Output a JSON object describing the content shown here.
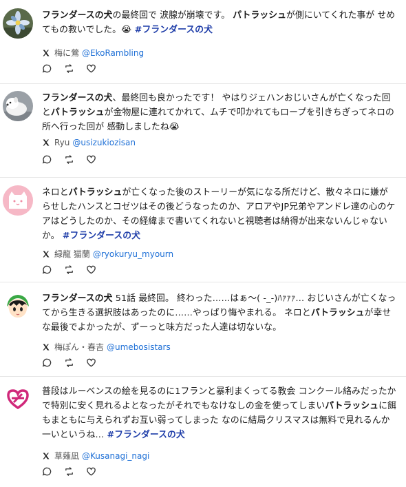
{
  "posts": [
    {
      "segments": [
        {
          "t": "フランダースの犬",
          "s": "b"
        },
        {
          "t": "の最終回で 涙腺が崩壊です。 ",
          "s": ""
        },
        {
          "t": "パトラッシュ",
          "s": "b"
        },
        {
          "t": "が側にいてくれた事が せめてもの救いでした。",
          "s": ""
        },
        {
          "t": "😭",
          "s": ""
        },
        {
          "t": " #フランダースの犬",
          "s": "tag"
        }
      ],
      "name": "梅に鶯",
      "handle": "@EkoRambling",
      "avatar": "flower-avatar"
    },
    {
      "segments": [
        {
          "t": "フランダースの犬",
          "s": "b"
        },
        {
          "t": "、最終回も良かったです！ やはりジェハンおじいさんが亡くなった回と",
          "s": ""
        },
        {
          "t": "パトラッシュ",
          "s": "b"
        },
        {
          "t": "が金物屋に連れてかれて、ムチで叩かれてもロープを引きちぎってネロの所へ行った回が 感動しましたね",
          "s": ""
        },
        {
          "t": "😭",
          "s": ""
        }
      ],
      "name": "Ryu",
      "handle": "@usizukiozisan",
      "avatar": "dog-avatar"
    },
    {
      "segments": [
        {
          "t": "ネロと",
          "s": ""
        },
        {
          "t": "パトラッシュ",
          "s": "b"
        },
        {
          "t": "が亡くなった後のストーリーが気になる所だけど、散々ネロに嫌がらせしたハンスとコゼツはその後どうなったのか、アロアやJP兄弟やアンドレ達の心のケアはどうしたのか、その経緯まで書いてくれないと視聴者は納得が出来ないんじゃないか。 ",
          "s": ""
        },
        {
          "t": "#フランダースの犬",
          "s": "tag"
        }
      ],
      "name": "緑龍 猫蘭",
      "handle": "@ryokuryu_myourn",
      "avatar": "cat-avatar"
    },
    {
      "segments": [
        {
          "t": "フランダースの犬",
          "s": "b"
        },
        {
          "t": " 51話 最終回。 終わった……はぁ〜( -_-)ﾊｧｧｧ… おじいさんが亡くなってから生きる選択肢はあったのに……やっぱり悔やまれる。 ネロと",
          "s": ""
        },
        {
          "t": "パトラッシュ",
          "s": "b"
        },
        {
          "t": "が幸せな最後でよかったが、ずーっと味方だった人達は切ないな。",
          "s": ""
        }
      ],
      "name": "梅ぽん・春吉",
      "handle": "@umebosistars",
      "avatar": "girl-avatar"
    },
    {
      "segments": [
        {
          "t": "普段はルーベンスの絵を見るのに1フランと暴利まくってる教会 コンクール絡みだったかで特別に安く見れるよとなったがそれでもなけなしの金を使ってしまい",
          "s": ""
        },
        {
          "t": "パトラッシュ",
          "s": "b"
        },
        {
          "t": "に餌もまともに与えられずお互い弱ってしまった なのに結局クリスマスは無料で見れるんか一いというね… ",
          "s": ""
        },
        {
          "t": "#フランダースの犬",
          "s": "tag"
        }
      ],
      "name": "草薙凪",
      "handle": "@Kusanagi_nagi",
      "avatar": "heart-avatar"
    }
  ],
  "colors": {
    "link": "#1d6fd6",
    "hashtag": "#1d3ca8",
    "divider": "#e6e6e6"
  },
  "icons": [
    "x-logo-icon",
    "reply-icon",
    "repost-icon",
    "like-icon"
  ]
}
